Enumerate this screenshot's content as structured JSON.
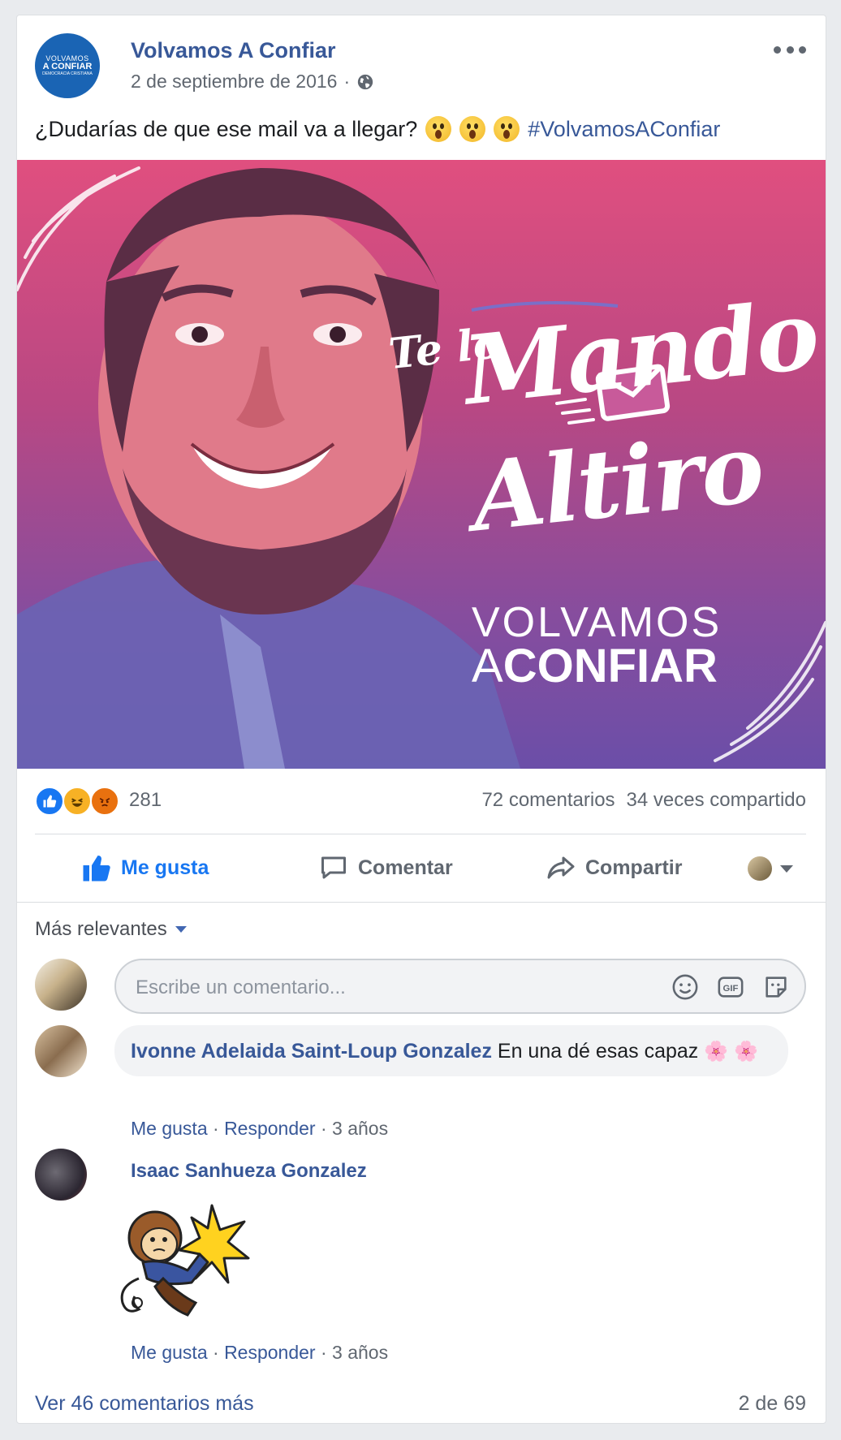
{
  "post": {
    "page_name": "Volvamos A Confiar",
    "avatar_lines": [
      "VOLVAMOS",
      "A CONFIAR",
      "DEMOCRACIA CRISTIANA"
    ],
    "date": "2 de septiembre de 2016",
    "separator": "·",
    "audience_icon": "globe-icon",
    "text": "¿Dudarías de que ese mail va a llegar?",
    "emojis": [
      "wow-emoji",
      "wow-emoji",
      "wow-emoji"
    ],
    "hashtag": "#VolvamosAConfiar",
    "image": {
      "line1": "Te lo",
      "line2": "Mando",
      "line3": "Altiro",
      "brand_top": "VOLVAMOS",
      "brand_bottom_a": "A",
      "brand_bottom_b": "CONFIAR",
      "gradient_top": "#e04f7f",
      "gradient_bottom": "#6b4ea8"
    }
  },
  "reactions": {
    "types": [
      "like",
      "haha",
      "angry"
    ],
    "count": "281",
    "comments": "72 comentarios",
    "shares": "34 veces compartido"
  },
  "actions": {
    "like": "Me gusta",
    "comment": "Comentar",
    "share": "Compartir",
    "like_color": "#1877f2"
  },
  "comments_section": {
    "sort_label": "Más relevantes",
    "composer_placeholder": "Escribe un comentario...",
    "composer_icons": [
      "smiley-icon",
      "gif-icon",
      "sticker-icon"
    ],
    "items": [
      {
        "author": "Ivonne Adelaida Saint-Loup Gonzalez",
        "text": "En una dé esas capaz",
        "emoji": "🌸",
        "like": "Me gusta",
        "reply": "Responder",
        "sep": "·",
        "age": "3 años"
      },
      {
        "author": "Isaac Sanhueza Gonzalez",
        "sticker": "monkey-punch-sticker",
        "like": "Me gusta",
        "reply": "Responder",
        "sep": "·",
        "age": "3 años"
      }
    ],
    "view_more": "Ver 46 comentarios más",
    "page_count": "2 de 69"
  }
}
